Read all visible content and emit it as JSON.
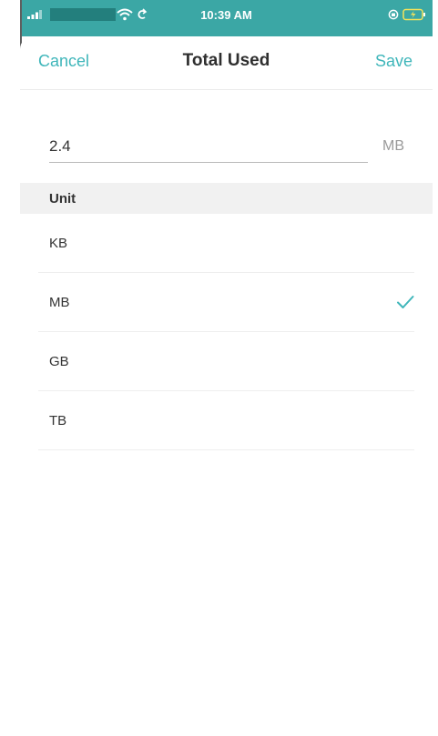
{
  "status_bar": {
    "time": "10:39 AM",
    "background_color": "#3ba7a5",
    "icons": [
      "signal-icon",
      "wifi-icon",
      "sync-icon",
      "orientation-lock-icon",
      "battery-charging-icon"
    ]
  },
  "nav": {
    "cancel_label": "Cancel",
    "title": "Total Used",
    "save_label": "Save",
    "accent_color": "#3fb6ba"
  },
  "value_field": {
    "value": "2.4",
    "unit": "MB"
  },
  "unit_section": {
    "header": "Unit",
    "options": [
      {
        "label": "KB",
        "selected": false
      },
      {
        "label": "MB",
        "selected": true
      },
      {
        "label": "GB",
        "selected": false
      },
      {
        "label": "TB",
        "selected": false
      }
    ],
    "selected_icon": "checkmark-icon"
  }
}
